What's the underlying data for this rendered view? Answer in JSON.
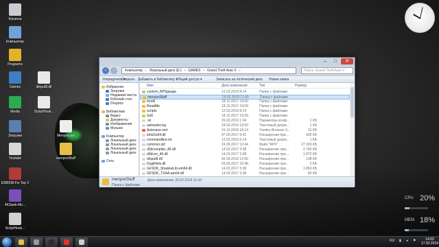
{
  "desktop": {
    "icons": [
      {
        "label": "Корзина",
        "color": "#c9ccd1"
      },
      {
        "label": "Компьютер",
        "color": "#6fa3d8"
      },
      {
        "label": "Programs",
        "color": "#e3b12a"
      },
      {
        "label": "Games",
        "color": "#3d7fc4"
      },
      {
        "label": "Media",
        "color": "#2eaa50"
      },
      {
        "label": "Загрузки",
        "color": "#5a7fb0"
      },
      {
        "label": "Youtube",
        "color": "#d8d8d8"
      },
      {
        "label": "ERBSW-Fix Top Speed...",
        "color": "#b13a3a"
      },
      {
        "label": "4KSaek-Mo...",
        "color": "#7a4fb8"
      },
      {
        "label": "ScriptHook...",
        "color": "#cfcfcf"
      },
      {
        "label": "dinput8.dll",
        "color": "#e9e9e9"
      },
      {
        "label": "ScriptHook...",
        "color": "#e9e9e9"
      },
      {
        "label": "Menyoo.asi",
        "color": "#eeeeee"
      },
      {
        "label": "menyooStuff",
        "color": "#e6bf47"
      }
    ]
  },
  "gadgets": {
    "clock": {
      "face": "clock-face"
    },
    "cpu": {
      "label": "CPU",
      "value": "20%",
      "fraction": 0.2
    },
    "mem": {
      "label": "MEM",
      "value": "18%",
      "fraction": 0.18
    }
  },
  "window": {
    "controls": {
      "minimize": "–",
      "maximize": "□",
      "close": "✕"
    },
    "breadcrumb": [
      "Компьютер",
      "Локальный диск (E:)",
      "GAMES",
      "Grand Theft Auto V"
    ],
    "search_placeholder": "Поиск: Grand Theft Auto V",
    "toolbar": [
      "Упорядочить ▾",
      "Открыть",
      "Добавить в библиотеку ▾",
      "Общий доступ ▾",
      "Записать на оптический диск",
      "Новая папка"
    ],
    "nav": [
      {
        "label": "Избранное",
        "color": "#e6bf47",
        "indent": 0
      },
      {
        "label": "Загрузки",
        "color": "#3d7fc4",
        "indent": 1
      },
      {
        "label": "Недавние места",
        "color": "#8aa4c4",
        "indent": 1
      },
      {
        "label": "Рабочий стол",
        "color": "#3d7fc4",
        "indent": 1
      },
      {
        "label": "Dropbox",
        "color": "#3d7fc4",
        "indent": 1
      },
      {
        "label": "",
        "color": "",
        "indent": 0
      },
      {
        "label": "Библиотеки",
        "color": "#e6bf47",
        "indent": 0
      },
      {
        "label": "Видео",
        "color": "#6d8fb8",
        "indent": 1
      },
      {
        "label": "Документы",
        "color": "#e6bf47",
        "indent": 1
      },
      {
        "label": "Изображения",
        "color": "#6d8fb8",
        "indent": 1
      },
      {
        "label": "Музыка",
        "color": "#6d8fb8",
        "indent": 1
      },
      {
        "label": "",
        "color": "",
        "indent": 0
      },
      {
        "label": "Компьютер",
        "color": "#6fa3d8",
        "indent": 0
      },
      {
        "label": "Локальный диск",
        "color": "#8a96a6",
        "indent": 1
      },
      {
        "label": "Локальный диск",
        "color": "#8a96a6",
        "indent": 1
      },
      {
        "label": "Локальный диск",
        "color": "#8a96a6",
        "indent": 1
      },
      {
        "label": "Локальный диск",
        "color": "#8a96a6",
        "indent": 1
      },
      {
        "label": "",
        "color": "",
        "indent": 0
      },
      {
        "label": "Сеть",
        "color": "#6fa3d8",
        "indent": 0
      }
    ],
    "columns": {
      "name": "Имя",
      "date": "Дата изменения",
      "type": "Тип",
      "size": "Размер"
    },
    "files": [
      {
        "name": "custom_RPSgauge",
        "date": "12.03.2019 8:14",
        "type": "Папка с файлами",
        "size": "",
        "color": "#e6bf47",
        "selected": false
      },
      {
        "name": "menyooStuff",
        "date": "20.02.2019 11:43",
        "type": "Папка с файлами",
        "size": "",
        "color": "#e6bf47",
        "selected": true
      },
      {
        "name": "mods",
        "date": "18.10.2017 19:00",
        "type": "Папка с файлами",
        "size": "",
        "color": "#e6bf47",
        "selected": false
      },
      {
        "name": "ReadMe",
        "date": "18.10.2017 19:09",
        "type": "Папка с файлами",
        "size": "",
        "color": "#e6bf47",
        "selected": false
      },
      {
        "name": "scripts",
        "date": "12.03.2019 8:14",
        "type": "Папка с файлами",
        "size": "",
        "color": "#e6bf47",
        "selected": false
      },
      {
        "name": "Soft",
        "date": "18.10.2017 19:09",
        "type": "Папка с файлами",
        "size": "",
        "color": "#e6bf47",
        "selected": false
      },
      {
        "name": ".ini",
        "date": "26.02.2019 1:34",
        "type": "Параметры конф...",
        "size": "1 КБ",
        "color": "#d8d8d8",
        "selected": false
      },
      {
        "name": "asiloader.log",
        "date": "24.02.2019 13:50",
        "type": "Текстовый докум...",
        "size": "1 КБ",
        "color": "#d8d8d8",
        "selected": false
      },
      {
        "name": "Autosave.xml",
        "date": "15.10.2018 18:14",
        "type": "Yandex Browser X...",
        "size": "31 КБ",
        "color": "#e86a3a",
        "selected": false
      },
      {
        "name": "bink2w64.dll",
        "date": "07.09.2017 9:41",
        "type": "Расширение при...",
        "size": "426 КБ",
        "color": "#d8d8d8",
        "selected": false
      },
      {
        "name": "commandline.txt",
        "date": "12.03.2019 6:14",
        "type": "Текстовый докум...",
        "size": "1 КБ",
        "color": "#d8d8d8",
        "selected": false
      },
      {
        "name": "common.rpf",
        "date": "24.09.2017 12:44",
        "type": "Файл \"RPF\"",
        "size": "27 093 КБ",
        "color": "#d8d8d8",
        "selected": false
      },
      {
        "name": "d3dcompiler_46.dll",
        "date": "14.03.2017 3:38",
        "type": "Расширение при...",
        "size": "3 783 КБ",
        "color": "#d8d8d8",
        "selected": false
      },
      {
        "name": "d3dcsx_46.dll",
        "date": "14.03.2017 3:38",
        "type": "Расширение при...",
        "size": "1 872 КБ",
        "color": "#d8d8d8",
        "selected": false
      },
      {
        "name": "dinput8.dll",
        "date": "02.05.2019 12:55",
        "type": "Расширение при...",
        "size": "128 КБ",
        "color": "#d8d8d8",
        "selected": false
      },
      {
        "name": "DxgiHelix.dll",
        "date": "09.06.2017 15:48",
        "type": "Расширение при...",
        "size": "2 КБ",
        "color": "#d8d8d8",
        "selected": false
      },
      {
        "name": "GFSDK_ShadowLib.win64.dll",
        "date": "14.03.2017 3:38",
        "type": "Расширение при...",
        "size": "1 863 КБ",
        "color": "#d8d8d8",
        "selected": false
      },
      {
        "name": "GFSDK_TXAA.win64.dll",
        "date": "14.03.2017 3:38",
        "type": "Расширение при...",
        "size": "86 КБ",
        "color": "#d8d8d8",
        "selected": false
      },
      {
        "name": "GFSDK_TXAA_AlphaResolve.win64.dll",
        "date": "14.03.2017 3:38",
        "type": "Расширение при...",
        "size": "84 КБ",
        "color": "#d8d8d8",
        "selected": false
      }
    ],
    "details": {
      "name": "menyooStuff",
      "modified": "Дата изменения: 20.02.2019 11:43",
      "type": "Папка с файлами"
    }
  },
  "taskbar": {
    "buttons": [
      {
        "name": "explorer",
        "color": "#e6bf47"
      },
      {
        "name": "media",
        "color": "#9a9a9a"
      },
      {
        "name": "windows",
        "color": "#2d2d2d"
      },
      {
        "name": "yandex",
        "color": "#e0342b"
      },
      {
        "name": "app",
        "color": "#cfcfcf"
      }
    ],
    "lang": "RU",
    "time": "14:02",
    "date": "17.02.2019"
  }
}
